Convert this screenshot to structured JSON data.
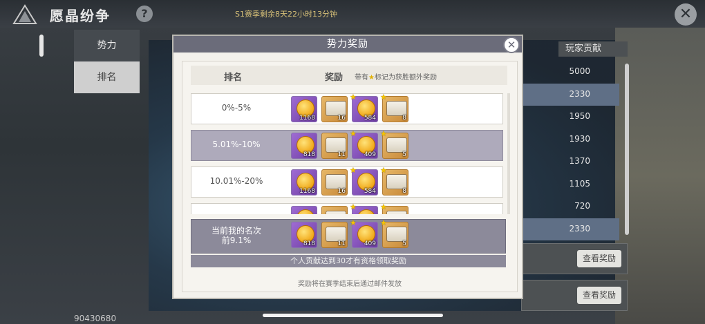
{
  "app": {
    "title": "愿晶纷争",
    "help_label": "?",
    "season_text": "S1赛季剩余8天22小时13分钟",
    "close_label": "✕",
    "uid": "90430680"
  },
  "side_tabs": [
    {
      "label": "势力"
    },
    {
      "label": "排名"
    }
  ],
  "contribution": {
    "header": "玩家贡献",
    "values": [
      "5000",
      "2330",
      "1950",
      "1930",
      "1370",
      "1105",
      "720",
      "2330"
    ],
    "view_reward_label": "查看奖励"
  },
  "modal": {
    "title": "势力奖励",
    "close_label": "✕",
    "col_rank": "排名",
    "col_reward": "奖励",
    "note_prefix": "带有",
    "note_suffix": "标记为获胜额外奖励",
    "rows": [
      {
        "rank": "0%-5%",
        "items": [
          {
            "kind": "coin",
            "qty": "1168",
            "bonus": false
          },
          {
            "kind": "chest",
            "qty": "16",
            "bonus": false
          },
          {
            "kind": "coin",
            "qty": "584",
            "bonus": true
          },
          {
            "kind": "chest",
            "qty": "8",
            "bonus": true
          }
        ]
      },
      {
        "rank": "5.01%-10%",
        "items": [
          {
            "kind": "coin",
            "qty": "818",
            "bonus": false
          },
          {
            "kind": "chest",
            "qty": "11",
            "bonus": false
          },
          {
            "kind": "coin",
            "qty": "409",
            "bonus": true
          },
          {
            "kind": "chest",
            "qty": "5",
            "bonus": true
          }
        ]
      },
      {
        "rank": "10.01%-20%",
        "items": [
          {
            "kind": "coin",
            "qty": "1168",
            "bonus": false
          },
          {
            "kind": "chest",
            "qty": "16",
            "bonus": false
          },
          {
            "kind": "coin",
            "qty": "584",
            "bonus": true
          },
          {
            "kind": "chest",
            "qty": "8",
            "bonus": true
          }
        ]
      },
      {
        "rank": "",
        "items": [
          {
            "kind": "coin",
            "qty": "",
            "bonus": false
          },
          {
            "kind": "chest",
            "qty": "",
            "bonus": false
          },
          {
            "kind": "coin",
            "qty": "",
            "bonus": true
          },
          {
            "kind": "chest",
            "qty": "",
            "bonus": true
          }
        ]
      }
    ],
    "my_rank": {
      "line1": "当前我的名次",
      "line2": "前9.1%",
      "items": [
        {
          "kind": "coin",
          "qty": "818",
          "bonus": false
        },
        {
          "kind": "chest",
          "qty": "11",
          "bonus": false
        },
        {
          "kind": "coin",
          "qty": "409",
          "bonus": true
        },
        {
          "kind": "chest",
          "qty": "5",
          "bonus": true
        }
      ]
    },
    "eligibility_notice": "个人贡献达到30才有资格领取奖励",
    "footer_note": "奖励将在赛季结束后通过邮件发放"
  },
  "colors": {
    "modal_header": "#6b6c7a",
    "alt_row": "#aeaabb",
    "season_text": "#d7c078"
  },
  "icons": [
    "game-logo-icon",
    "help-icon",
    "close-icon",
    "coin-icon",
    "chest-icon",
    "bonus-star-icon"
  ]
}
